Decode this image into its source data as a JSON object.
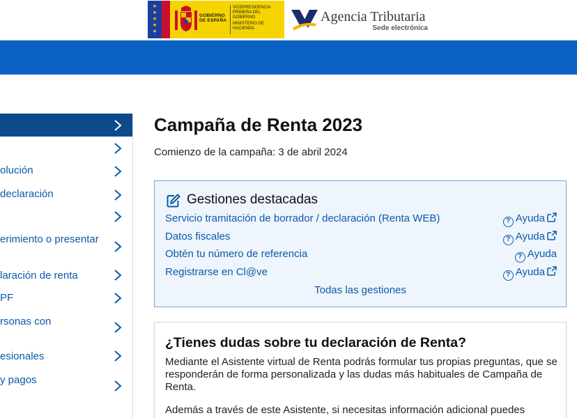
{
  "header": {
    "gov_logo": {
      "line1": "GOBIERNO DE ESPAÑA",
      "line2": "VICEPRESIDENCIA PRIMERA DEL GOBIERNO",
      "line3": "MINISTERIO DE HACIENDA"
    },
    "agency": {
      "title": "Agencia Tributaria",
      "subtitle": "Sede electrónica"
    },
    "colors": {
      "band": "#0a62c4",
      "gov_yellow": "#f5d400"
    }
  },
  "sidebar": {
    "items": [
      {
        "label": "",
        "active": true
      },
      {
        "label": ""
      },
      {
        "label": "olución"
      },
      {
        "label": "declaración"
      },
      {
        "label": ""
      },
      {
        "label": "erimiento o presentar"
      },
      {
        "label": "laración de renta"
      },
      {
        "label": "PF"
      },
      {
        "label": "rsonas con"
      },
      {
        "label": "esionales"
      },
      {
        "label": "y pagos"
      }
    ],
    "icon": "chevron-right-icon"
  },
  "main": {
    "title": "Campaña de Renta 2023",
    "campaign_start": "Comienzo de la campaña: 3 de abril 2024",
    "gestiones": {
      "title": "Gestiones destacadas",
      "icon": "edit-icon",
      "rows": [
        {
          "label": "Servicio tramitación de borrador / declaración (Renta WEB)",
          "help": "Ayuda",
          "external": true
        },
        {
          "label": "Datos fiscales",
          "help": "Ayuda",
          "external": true
        },
        {
          "label": "Obtén tu número de referencia",
          "help": "Ayuda",
          "external": false
        },
        {
          "label": "Registrarse en Cl@ve",
          "help": "Ayuda",
          "external": true
        }
      ],
      "all_link": "Todas las gestiones"
    },
    "dudas": {
      "title": "¿Tienes dudas sobre tu declaración de Renta?",
      "p1": "Mediante el Asistente virtual de Renta podrás formular tus propias preguntas, que se responderán de forma personalizada y las dudas más habituales de Campaña de Renta.",
      "p2": "Además a través de este Asistente, si necesitas información adicional puedes"
    }
  }
}
